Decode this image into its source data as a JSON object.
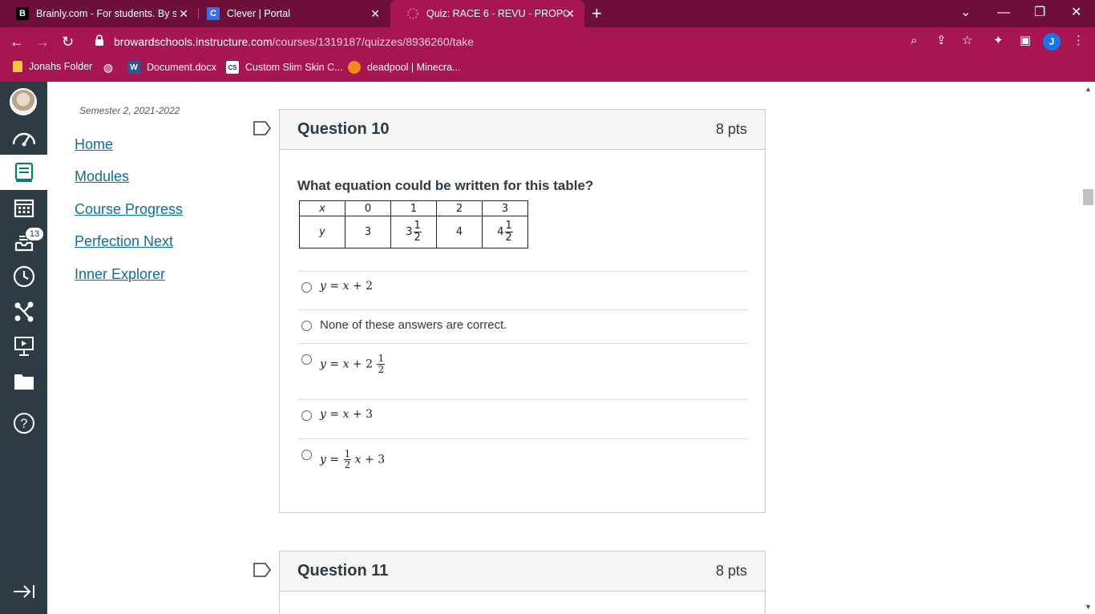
{
  "browser": {
    "tabs": [
      {
        "title": "Brainly.com - For students. By stu",
        "favicon": "B",
        "active": false
      },
      {
        "title": "Clever | Portal",
        "favicon": "C",
        "active": false
      },
      {
        "title": "Quiz: RACE 6 - REVU - PROPORTI",
        "favicon": "spinner",
        "active": true
      }
    ],
    "new_tab_label": "+",
    "url_host": "browardschools.instructure.com",
    "url_path": "/courses/1319187/quizzes/8936260/take",
    "profile_initial": "J",
    "bookmarks": [
      {
        "label": "Jonahs Folder",
        "icon": "folder-icon"
      },
      {
        "label": "",
        "icon": "globe-icon"
      },
      {
        "label": "Document.docx",
        "icon": "word-icon"
      },
      {
        "label": "Custom Slim Skin C...",
        "icon": "cs-icon"
      },
      {
        "label": "deadpool | Minecra...",
        "icon": "pumpkin-icon"
      }
    ],
    "colors": {
      "tabbar": "#6e0f3a",
      "toolbar": "#a71651"
    }
  },
  "global_nav": {
    "inbox_badge": "13",
    "items": [
      "account",
      "dashboard",
      "courses",
      "calendar",
      "inbox",
      "history",
      "commons",
      "studio",
      "files",
      "help"
    ],
    "active": "courses",
    "collapse_label": "collapse"
  },
  "course_nav": {
    "term": "Semester 2, 2021-2022",
    "links": [
      "Home",
      "Modules",
      "Course Progress",
      "Perfection Next",
      "Inner Explorer"
    ]
  },
  "questions": [
    {
      "title": "Question 10",
      "points": "8 pts",
      "text": "What equation could be written for this table?",
      "table": {
        "row_x_label": "x",
        "row_y_label": "y",
        "x_values": [
          "0",
          "1",
          "2",
          "3"
        ],
        "y_values": [
          "3",
          "3 1/2",
          "4",
          "4 1/2"
        ]
      },
      "answers": [
        "y = x + 2",
        "None of these answers are correct.",
        "y = x + 2 1/2",
        "y = x + 3",
        "y = 1/2 x + 3"
      ]
    },
    {
      "title": "Question 11",
      "points": "8 pts"
    }
  ]
}
